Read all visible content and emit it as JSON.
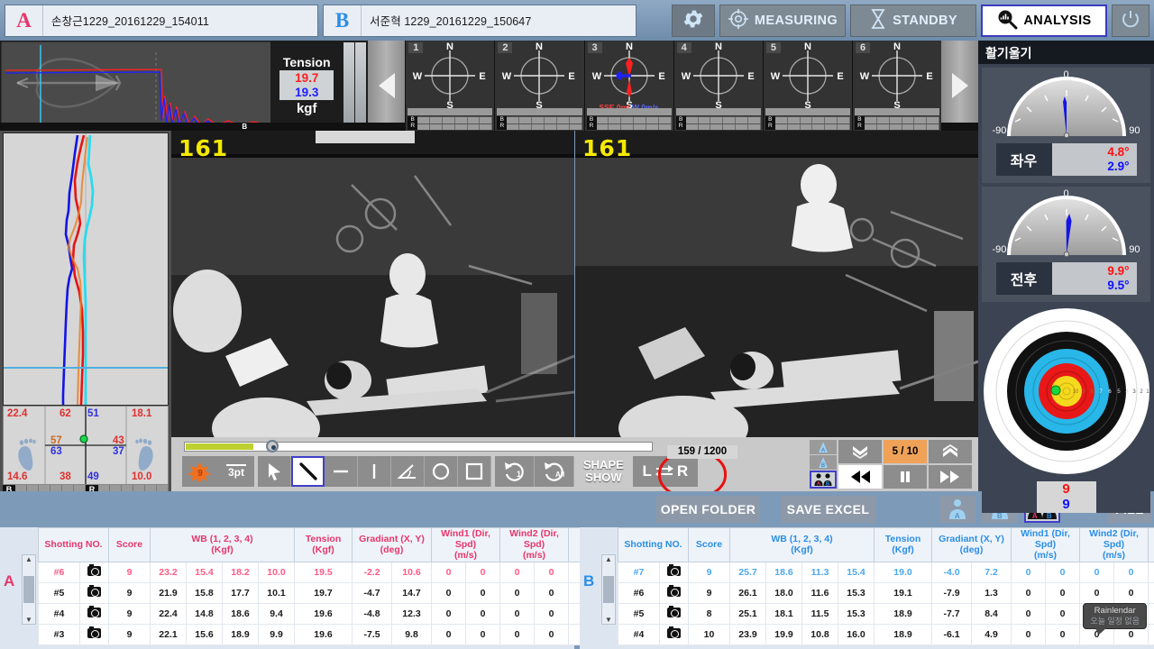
{
  "topbar": {
    "slot_a_letter": "A",
    "slot_a_name": "손창근1229_20161229_154011",
    "slot_b_letter": "B",
    "slot_b_name": "서준혁 1229_20161229_150647",
    "measuring_label": "MEASURING",
    "standby_label": "STANDBY",
    "analysis_label": "ANALYSIS"
  },
  "tension": {
    "label": "Tension",
    "red_value": "19.7",
    "blue_value": "19.3",
    "unit": "kgf",
    "b_label": "B",
    "r_label": "R"
  },
  "compasses": [
    {
      "num": "1",
      "n": "N",
      "s": "S",
      "e": "E",
      "w": "W",
      "wind": "",
      "active": false
    },
    {
      "num": "2",
      "n": "N",
      "s": "S",
      "e": "E",
      "w": "W",
      "wind": "",
      "active": false
    },
    {
      "num": "3",
      "n": "N",
      "s": "S",
      "e": "E",
      "w": "W",
      "wind_dir1": "SSE",
      "wind_spd1": "0m/",
      "wind_dir2": "W",
      "wind_spd2": "0m/s",
      "active": true
    },
    {
      "num": "4",
      "n": "N",
      "s": "S",
      "e": "E",
      "w": "W",
      "wind": "",
      "active": false
    },
    {
      "num": "5",
      "n": "N",
      "s": "S",
      "e": "E",
      "w": "W",
      "wind": "",
      "active": false
    },
    {
      "num": "6",
      "n": "N",
      "s": "S",
      "e": "E",
      "w": "W",
      "wind": "",
      "active": false
    }
  ],
  "stance": {
    "top_left": "22.4",
    "top_mid_red": "62",
    "top_mid_blue": "51",
    "top_right": "18.1",
    "mid_left_orange": "57",
    "mid_left_blue": "63",
    "mid_right_red": "43",
    "mid_right_blue": "37",
    "bot_left": "14.6",
    "bot_mid_red": "38",
    "bot_mid_blue": "49",
    "bot_right": "10.0",
    "foot_b": "B",
    "foot_r": "R"
  },
  "video": {
    "left_frame": "161",
    "right_frame": "161"
  },
  "controls": {
    "frame_index": "159 / 1200",
    "pen_width": "3pt",
    "shape_show_line1": "SHAPE",
    "shape_show_line2": "SHOW",
    "lr_label_left": "L",
    "lr_label_right": "R",
    "play_counter": "5 / 10"
  },
  "footer": {
    "open_folder": "OPEN FOLDER",
    "save_excel": "SAVE EXCEL",
    "person_a": "A",
    "person_b": "B",
    "person_ab_a": "A",
    "person_ab_b": "B",
    "file": "FILE"
  },
  "sidebar": {
    "title": "활기울기",
    "gauges": [
      {
        "name": "좌우",
        "zero": "0",
        "min": "-90",
        "max": "90",
        "red": "4.8°",
        "blue": "2.9°",
        "needle_deg": -3
      },
      {
        "name": "전후",
        "zero": "0",
        "min": "-90",
        "max": "90",
        "red": "9.9°",
        "blue": "9.5°",
        "needle_deg": 4
      }
    ],
    "score_red": "9",
    "score_blue": "9"
  },
  "tables": {
    "headers": [
      "Shotting NO.",
      "",
      "Score",
      "WB (1, 2, 3, 4)\n(Kgf)",
      "Tension\n(Kgf)",
      "Gradiant (X, Y)\n(deg)",
      "Wind1 (Dir, Spd)\n(m/s)",
      "Wind2 (Dir, Spd)\n(m/s)"
    ],
    "header_labels": {
      "shot": "Shotting NO.",
      "score": "Score",
      "wb_l1": "WB (1, 2, 3, 4)",
      "wb_l2": "(Kgf)",
      "tension_l1": "Tension",
      "tension_l2": "(Kgf)",
      "grad_l1": "Gradiant (X, Y)",
      "grad_l2": "(deg)",
      "wind1_l1": "Wind1 (Dir, Spd)",
      "wind1_l2": "(m/s)",
      "wind2_l1": "Wind2 (Dir, Spd)",
      "wind2_l2": "(m/s)"
    },
    "a": {
      "label": "A",
      "rows": [
        {
          "shot": "#6",
          "score": "9",
          "wb": [
            "23.2",
            "15.4",
            "18.2",
            "10.0"
          ],
          "tension": "19.5",
          "grad": [
            "-2.2",
            "10.6"
          ],
          "wind1": [
            "0",
            "0"
          ],
          "wind2": [
            "0",
            "0"
          ],
          "highlight": true
        },
        {
          "shot": "#5",
          "score": "9",
          "wb": [
            "21.9",
            "15.8",
            "17.7",
            "10.1"
          ],
          "tension": "19.7",
          "grad": [
            "-4.7",
            "14.7"
          ],
          "wind1": [
            "0",
            "0"
          ],
          "wind2": [
            "0",
            "0"
          ],
          "highlight": false
        },
        {
          "shot": "#4",
          "score": "9",
          "wb": [
            "22.4",
            "14.8",
            "18.6",
            "9.4"
          ],
          "tension": "19.6",
          "grad": [
            "-4.8",
            "12.3"
          ],
          "wind1": [
            "0",
            "0"
          ],
          "wind2": [
            "0",
            "0"
          ],
          "highlight": false
        },
        {
          "shot": "#3",
          "score": "9",
          "wb": [
            "22.1",
            "15.6",
            "18.9",
            "9.9"
          ],
          "tension": "19.6",
          "grad": [
            "-7.5",
            "9.8"
          ],
          "wind1": [
            "0",
            "0"
          ],
          "wind2": [
            "0",
            "0"
          ],
          "highlight": false
        }
      ]
    },
    "b": {
      "label": "B",
      "rows": [
        {
          "shot": "#7",
          "score": "9",
          "wb": [
            "25.7",
            "18.6",
            "11.3",
            "15.4"
          ],
          "tension": "19.0",
          "grad": [
            "-4.0",
            "7.2"
          ],
          "wind1": [
            "0",
            "0"
          ],
          "wind2": [
            "0",
            "0"
          ],
          "highlight": true
        },
        {
          "shot": "#6",
          "score": "9",
          "wb": [
            "26.1",
            "18.0",
            "11.6",
            "15.3"
          ],
          "tension": "19.1",
          "grad": [
            "-7.9",
            "1.3"
          ],
          "wind1": [
            "0",
            "0"
          ],
          "wind2": [
            "0",
            "0"
          ],
          "highlight": false
        },
        {
          "shot": "#5",
          "score": "8",
          "wb": [
            "25.1",
            "18.1",
            "11.5",
            "15.3"
          ],
          "tension": "18.9",
          "grad": [
            "-7.7",
            "8.4"
          ],
          "wind1": [
            "0",
            "0"
          ],
          "wind2": [
            "0",
            "0"
          ],
          "highlight": false
        },
        {
          "shot": "#4",
          "score": "10",
          "wb": [
            "23.9",
            "19.9",
            "10.8",
            "16.0"
          ],
          "tension": "18.9",
          "grad": [
            "-6.1",
            "4.9"
          ],
          "wind1": [
            "0",
            "0"
          ],
          "wind2": [
            "0",
            "0"
          ],
          "highlight": false
        }
      ]
    }
  },
  "tooltip": {
    "title": "Rainlendar",
    "body": "오늘 일정 없음"
  },
  "colors": {
    "accent_a": "#e8366b",
    "accent_b": "#2a8ee8",
    "red": "#ff1010",
    "blue": "#1010ff",
    "chrome": "#7d9ab8"
  }
}
